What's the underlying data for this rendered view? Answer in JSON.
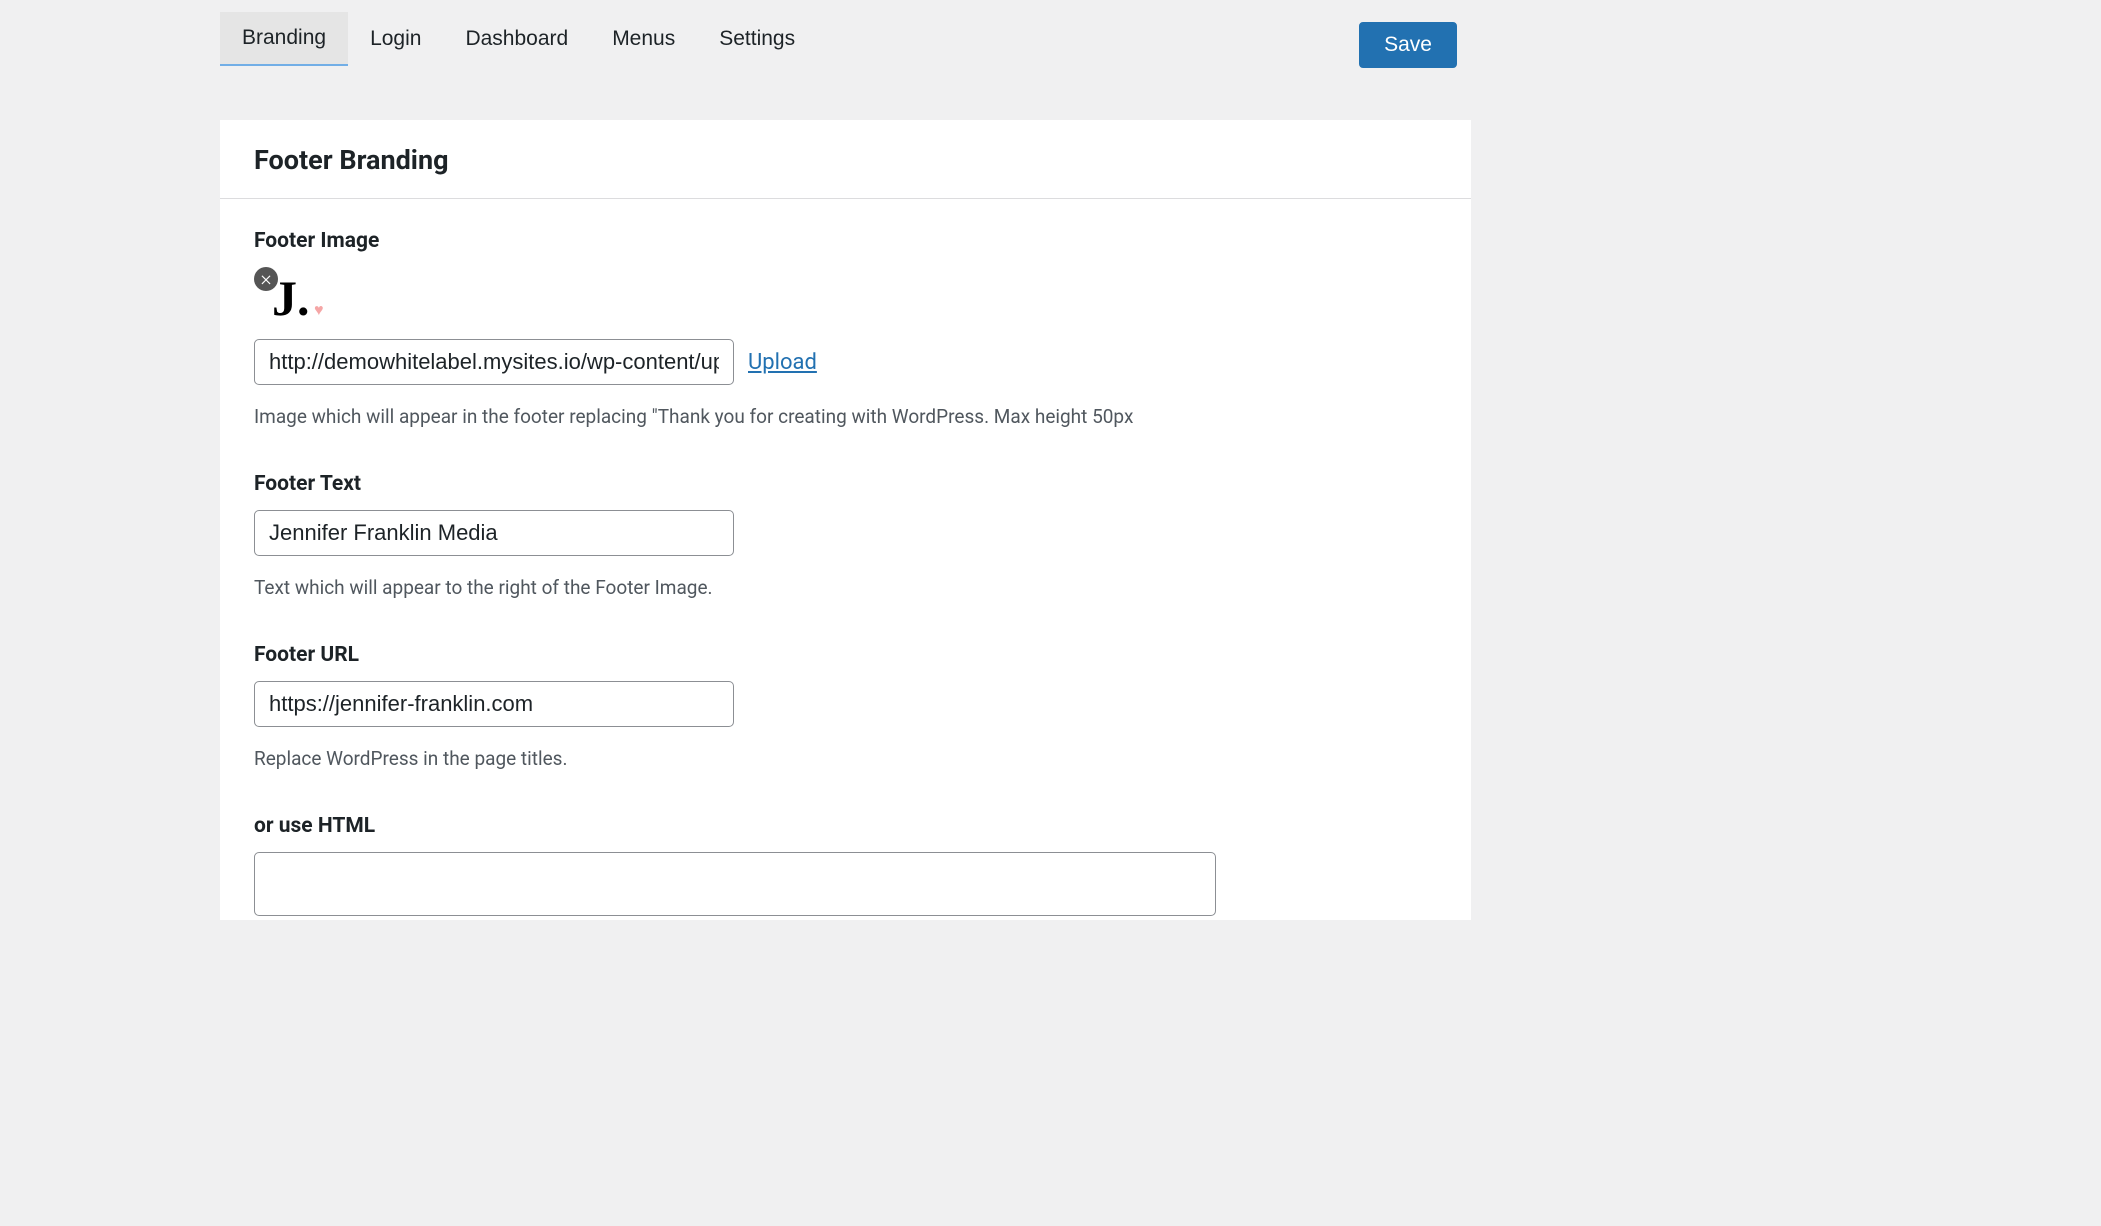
{
  "tabs": {
    "branding": "Branding",
    "login": "Login",
    "dashboard": "Dashboard",
    "menus": "Menus",
    "settings": "Settings"
  },
  "save_button": "Save",
  "card": {
    "title": "Footer Branding"
  },
  "footer_image": {
    "label": "Footer Image",
    "url_value": "http://demowhitelabel.mysites.io/wp-content/uploac",
    "upload_link": "Upload",
    "description": "Image which will appear in the footer replacing \"Thank you for creating with WordPress. Max height 50px"
  },
  "footer_text": {
    "label": "Footer Text",
    "value": "Jennifer Franklin Media",
    "description": "Text which will appear to the right of the Footer Image."
  },
  "footer_url": {
    "label": "Footer URL",
    "value": "https://jennifer-franklin.com",
    "description": "Replace WordPress in the page titles."
  },
  "footer_html": {
    "label": "or use HTML",
    "value": ""
  }
}
